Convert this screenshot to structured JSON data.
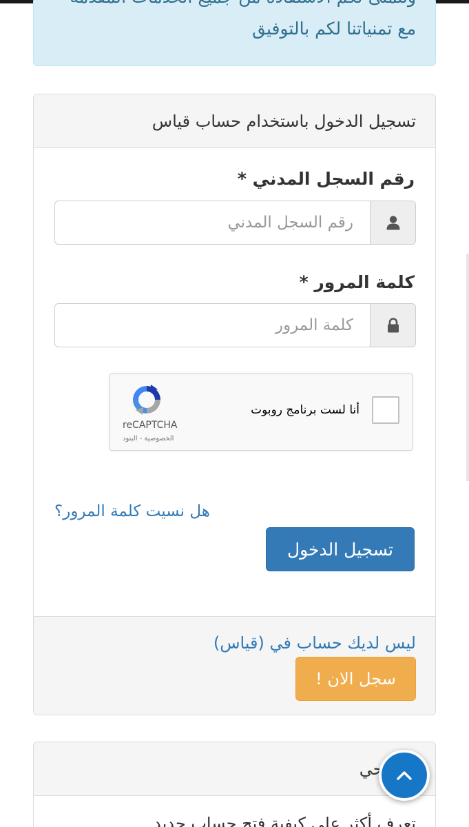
{
  "info_alert": {
    "clipped_line": "ونتمنى لكم الاستفادة من جميع الخدمات المقدمة",
    "line2": "مع تمنياتنا لكم بالتوفيق"
  },
  "login_panel": {
    "heading": "تسجيل الدخول باستخدام حساب قياس",
    "civil_id": {
      "label": "رقم السجل المدني *",
      "placeholder": "رقم السجل المدني"
    },
    "password": {
      "label": "كلمة المرور *",
      "placeholder": "كلمة المرور"
    },
    "recaptcha": {
      "label": "أنا لست برنامج روبوت",
      "brand": "reCAPTCHA",
      "links": "الخصوصية - البنود"
    },
    "forgot_link": "هل نسيت كلمة المرور؟",
    "login_button": "تسجيل الدخول",
    "footer": {
      "no_account": "ليس لديك حساب في (قياس)",
      "register_button": "سجل الان !"
    }
  },
  "info_panel": {
    "heading": "توضيحي",
    "body_partial": "تعرف أكثر على كيفية فتح حساب جديد"
  },
  "colors": {
    "primary": "#337ab7",
    "warning": "#f0ad4e",
    "info_bg": "#d9edf7",
    "info_text": "#31708f",
    "scroll_top": "#1577c5"
  },
  "icons": {
    "civil_id": "user-icon",
    "password": "lock-icon",
    "scroll_top": "chevron-up-icon"
  }
}
